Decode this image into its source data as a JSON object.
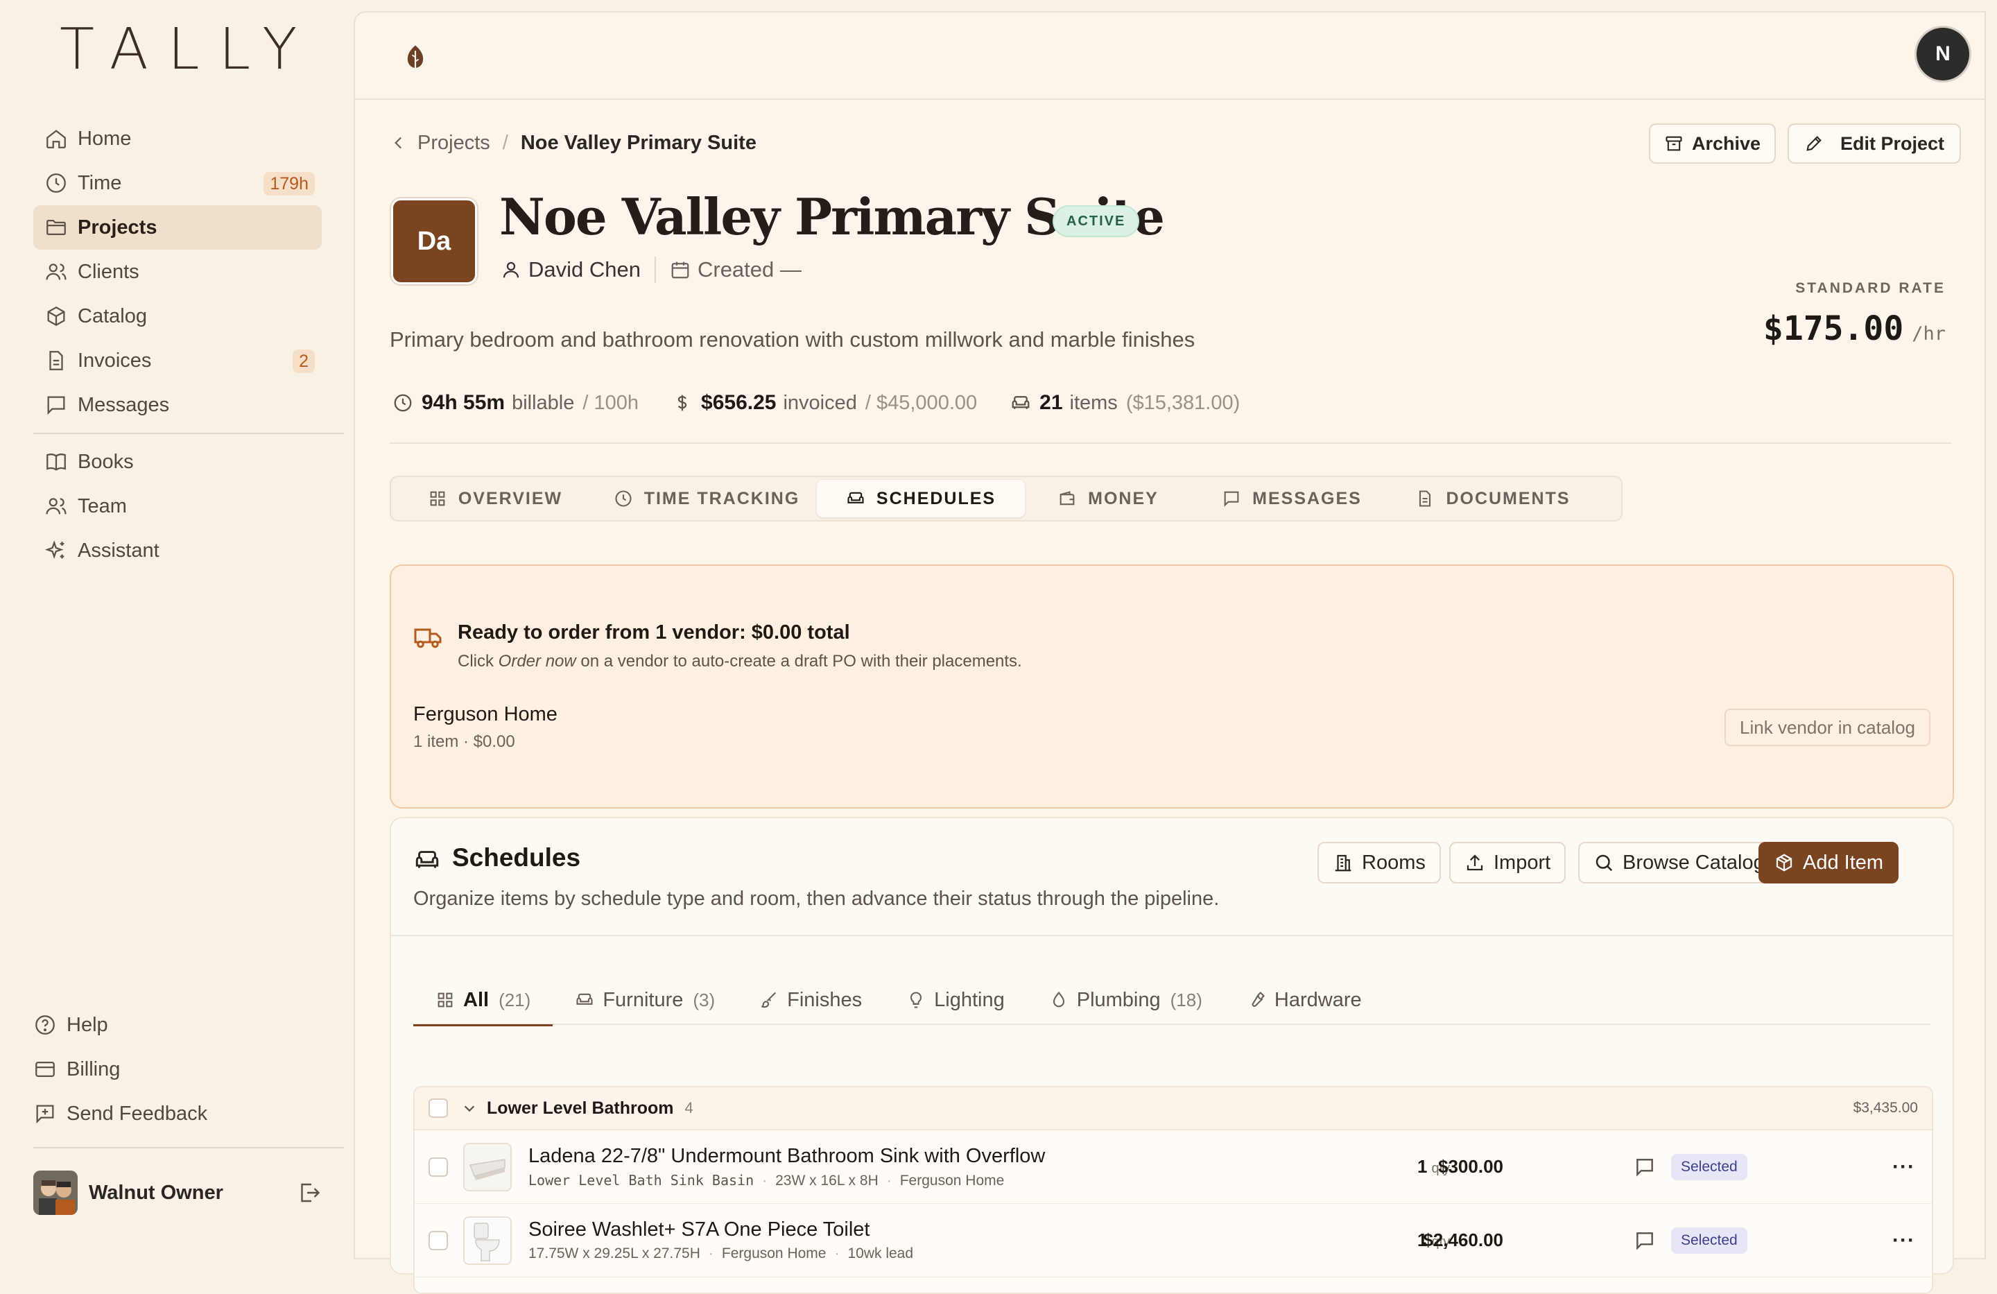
{
  "app": {
    "logo": "TALLY"
  },
  "sidebar": {
    "items": [
      {
        "label": "Home",
        "icon": "home-icon"
      },
      {
        "label": "Time",
        "icon": "clock-icon",
        "badge": "179h"
      },
      {
        "label": "Projects",
        "icon": "folder-icon",
        "active": true
      },
      {
        "label": "Clients",
        "icon": "users-icon"
      },
      {
        "label": "Catalog",
        "icon": "box-icon"
      },
      {
        "label": "Invoices",
        "icon": "file-icon",
        "badge": "2"
      },
      {
        "label": "Messages",
        "icon": "chat-icon"
      }
    ],
    "secondary": [
      {
        "label": "Books",
        "icon": "book-icon"
      },
      {
        "label": "Team",
        "icon": "users-icon"
      },
      {
        "label": "Assistant",
        "icon": "sparkle-icon"
      }
    ],
    "bottom": [
      {
        "label": "Help",
        "icon": "help-icon"
      },
      {
        "label": "Billing",
        "icon": "card-icon"
      },
      {
        "label": "Send Feedback",
        "icon": "feedback-icon"
      }
    ],
    "user": {
      "name": "Walnut Owner"
    }
  },
  "topbar": {
    "avatar_initial": "N"
  },
  "breadcrumb": {
    "parent": "Projects",
    "separator": "/",
    "current": "Noe Valley Primary Suite"
  },
  "actions": {
    "archive": "Archive",
    "edit": "Edit Project"
  },
  "project": {
    "initials": "Da",
    "title": "Noe Valley Primary Suite",
    "status": "ACTIVE",
    "client": "David Chen",
    "created": "Created —",
    "description": "Primary bedroom and bathroom renovation with custom millwork and marble finishes",
    "rate_label": "STANDARD RATE",
    "rate_value": "$175.00",
    "rate_unit": "/hr"
  },
  "stats": {
    "billable_value": "94h 55m",
    "billable_label": "billable",
    "billable_limit": "/ 100h",
    "invoiced_value": "$656.25",
    "invoiced_label": "invoiced",
    "invoiced_total": "/ $45,000.00",
    "items_value": "21",
    "items_label": "items",
    "items_total": "($15,381.00)"
  },
  "tabs": [
    {
      "label": "OVERVIEW",
      "icon": "grid-icon"
    },
    {
      "label": "TIME TRACKING",
      "icon": "clock-icon"
    },
    {
      "label": "SCHEDULES",
      "icon": "sofa-icon",
      "active": true
    },
    {
      "label": "MONEY",
      "icon": "wallet-icon"
    },
    {
      "label": "MESSAGES",
      "icon": "chat-icon"
    },
    {
      "label": "DOCUMENTS",
      "icon": "document-icon"
    }
  ],
  "order_panel": {
    "title": "Ready to order from 1 vendor: $0.00 total",
    "hint_pre": "Click ",
    "hint_em": "Order now",
    "hint_post": " on a vendor to auto-create a draft PO with their placements.",
    "vendor_name": "Ferguson Home",
    "vendor_sub": "1 item · $0.00",
    "link_button": "Link vendor in catalog"
  },
  "schedules": {
    "title": "Schedules",
    "description": "Organize items by schedule type and room, then advance their status through the pipeline.",
    "buttons": {
      "rooms": "Rooms",
      "import": "Import",
      "browse": "Browse Catalog",
      "add": "Add Item"
    },
    "tabs": [
      {
        "label": "All",
        "count": "(21)",
        "icon": "grid-icon",
        "active": true
      },
      {
        "label": "Furniture",
        "count": "(3)",
        "icon": "sofa-icon"
      },
      {
        "label": "Finishes",
        "count": "",
        "icon": "brush-icon"
      },
      {
        "label": "Lighting",
        "count": "",
        "icon": "bulb-icon"
      },
      {
        "label": "Plumbing",
        "count": "(18)",
        "icon": "drop-icon"
      },
      {
        "label": "Hardware",
        "count": "",
        "icon": "wrench-icon"
      }
    ],
    "group": {
      "name": "Lower Level Bathroom",
      "count": "4",
      "total": "$3,435.00",
      "items": [
        {
          "name": "Ladena 22-7/8\" Undermount Bathroom Sink with Overflow",
          "tag": "Lower Level Bath Sink Basin",
          "dims": "23W x 16L x 8H",
          "vendor": "Ferguson Home",
          "lead": "",
          "qty": "1",
          "qty_unit": "qty",
          "price": "$300.00",
          "status": "Selected"
        },
        {
          "name": "Soiree Washlet+ S7A One Piece Toilet",
          "tag": "",
          "dims": "17.75W x 29.25L x 27.75H",
          "vendor": "Ferguson Home",
          "lead": "10wk lead",
          "qty": "1",
          "qty_unit": "qty",
          "price": "$2,460.00",
          "status": "Selected"
        }
      ]
    }
  }
}
